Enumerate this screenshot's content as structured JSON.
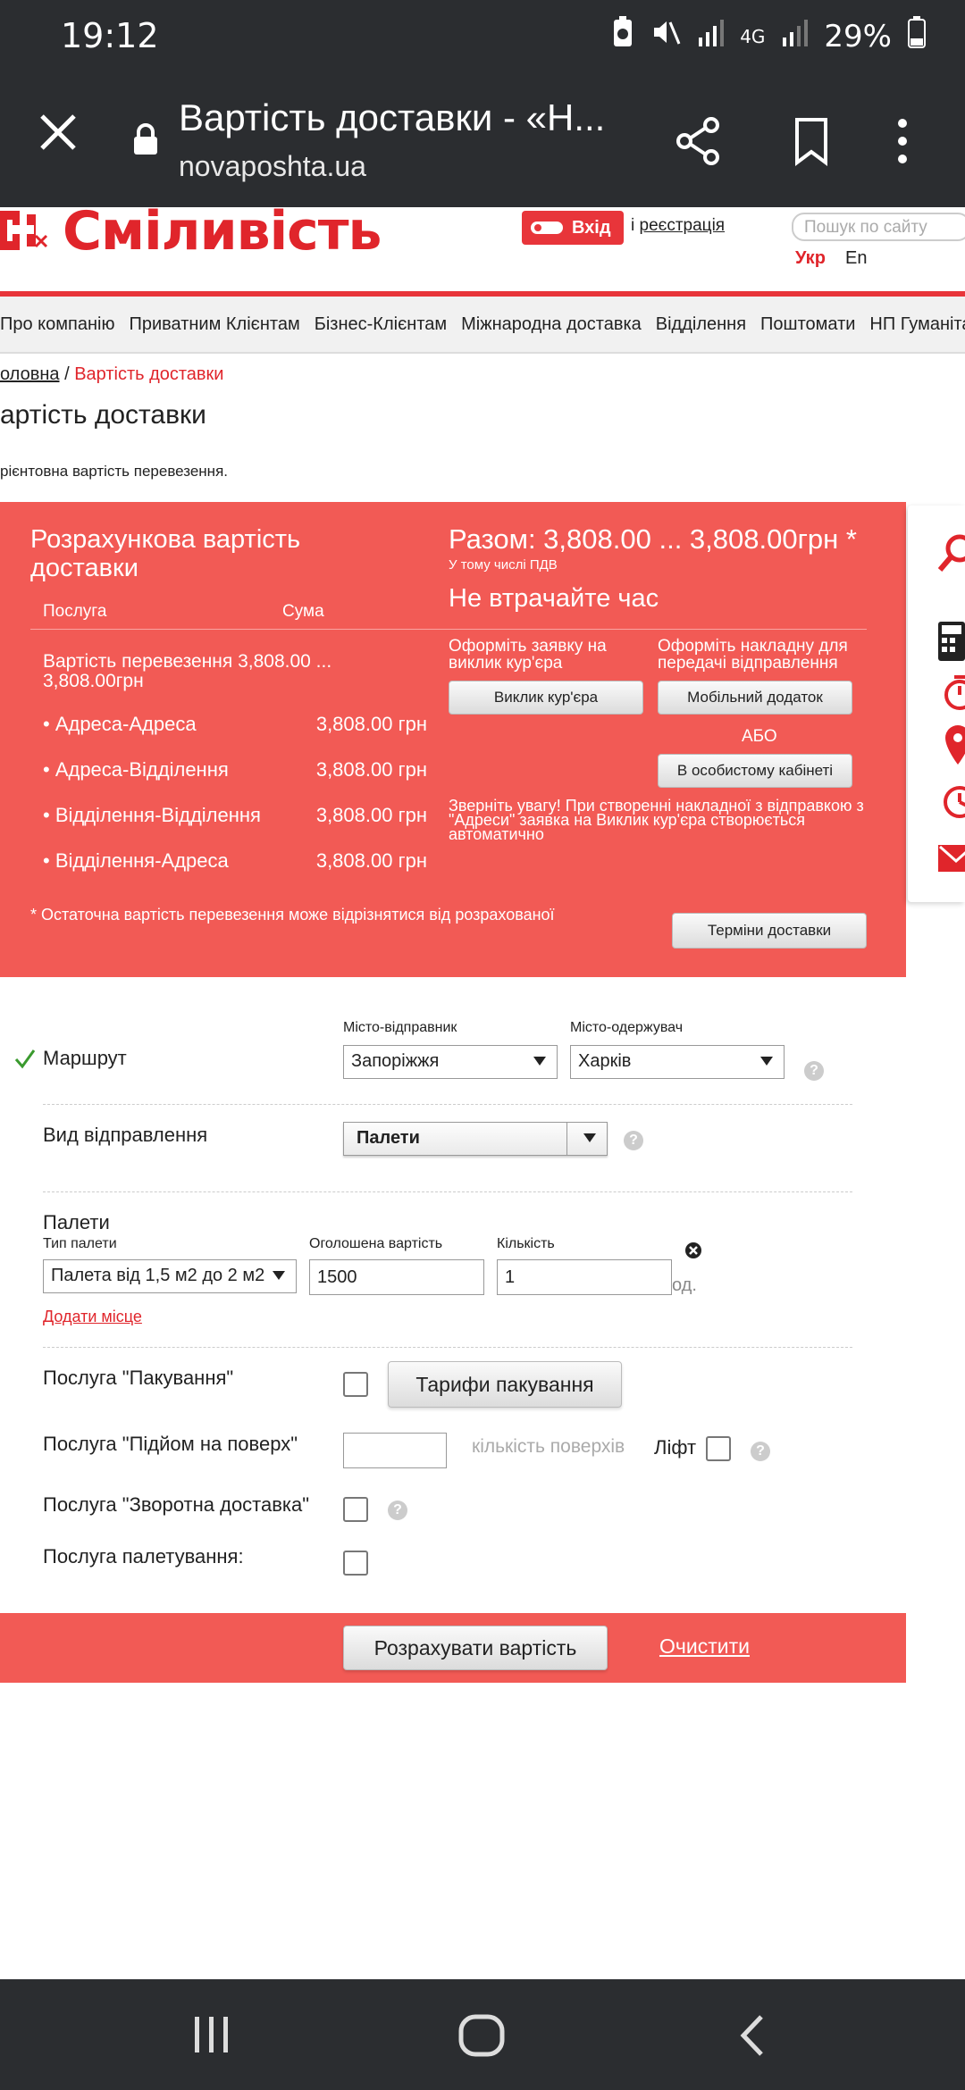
{
  "status": {
    "time": "19:12",
    "network": "4G",
    "battery": "29%"
  },
  "browser": {
    "title": "Вартість доставки - «Н...",
    "url": "novaposhta.ua"
  },
  "header": {
    "brand": "Сміливість",
    "login": "Вхід",
    "or": "і",
    "register": "реєстрація",
    "search_placeholder": "Пошук по сайту",
    "lang_ukr": "Укр",
    "lang_en": "En"
  },
  "nav": [
    "Про компанію",
    "Приватним Клієнтам",
    "Бізнес-Клієнтам",
    "Міжнародна доставка",
    "Відділення",
    "Поштомати",
    "НП Гуманітарна"
  ],
  "breadcrumb": {
    "home": "оловна",
    "sep": "/",
    "current": "Вартість доставки"
  },
  "page": {
    "title": "артість доставки",
    "note": "рієнтовна вартість перевезення."
  },
  "result": {
    "title": "Розрахункова вартість доставки",
    "col_service": "Послуга",
    "col_sum": "Сума",
    "cost_line": "Вартість перевезення 3,808.00 ... 3,808.00грн",
    "rows": [
      {
        "service": "• Адреса-Адреса",
        "sum": "3,808.00 грн"
      },
      {
        "service": "• Адреса-Відділення",
        "sum": "3,808.00 грн"
      },
      {
        "service": "• Відділення-Відділення",
        "sum": "3,808.00 грн"
      },
      {
        "service": "• Відділення-Адреса",
        "sum": "3,808.00 грн"
      }
    ],
    "total": "Разом: 3,808.00 ... 3,808.00грн *",
    "vat": "У тому числі ПДВ",
    "headline": "Не втрачайте час",
    "order_courier_text": "Оформіть заявку на виклик кур'єра",
    "order_waybill_text": "Оформіть накладну для передачі відправлення",
    "courier_btn": "Виклик кур'єра",
    "mobile_btn": "Мобільний додаток",
    "or_text": "АБО",
    "cabinet_btn": "В особистому кабінеті",
    "attention": "Зверніть увагу! При створенні накладної з відправкою з \"Адреси\" заявка на Виклик кур'єра створюється автоматично",
    "footnote": "* Остаточна вартість перевезення може відрізнятися від розрахованої",
    "terms_btn": "Терміни доставки"
  },
  "form": {
    "route_label": "Маршрут",
    "sender_city_label": "Місто-відправник",
    "sender_city": "Запоріжжя",
    "receiver_city_label": "Місто-одержувач",
    "receiver_city": "Харків",
    "shipment_type_label": "Вид відправлення",
    "shipment_type": "Палети",
    "pallets_label": "Палети",
    "pallet_type_label": "Тип палети",
    "pallet_type": "Палета від 1,5 м2 до 2 м2",
    "declared_value_label": "Оголошена вартість",
    "declared_value": "1500",
    "quantity_label": "Кількість",
    "quantity": "1",
    "unit": "од.",
    "add_place": "Додати місце",
    "packing_label": "Послуга \"Пакування\"",
    "packing_btn": "Тарифи пакування",
    "lift_floor_label": "Послуга \"Підйом на поверх\"",
    "floors_placeholder": "кількість поверхів",
    "lift_label": "Ліфт",
    "return_label": "Послуга \"Зворотна доставка\"",
    "palletizing_label": "Послуга палетування:",
    "calc_btn": "Розрахувати вартість",
    "clear_link": "Очистити"
  },
  "colors": {
    "brand_red": "#e0252b",
    "panel_red": "#f25a55",
    "chrome_dark": "#2b2d30"
  }
}
